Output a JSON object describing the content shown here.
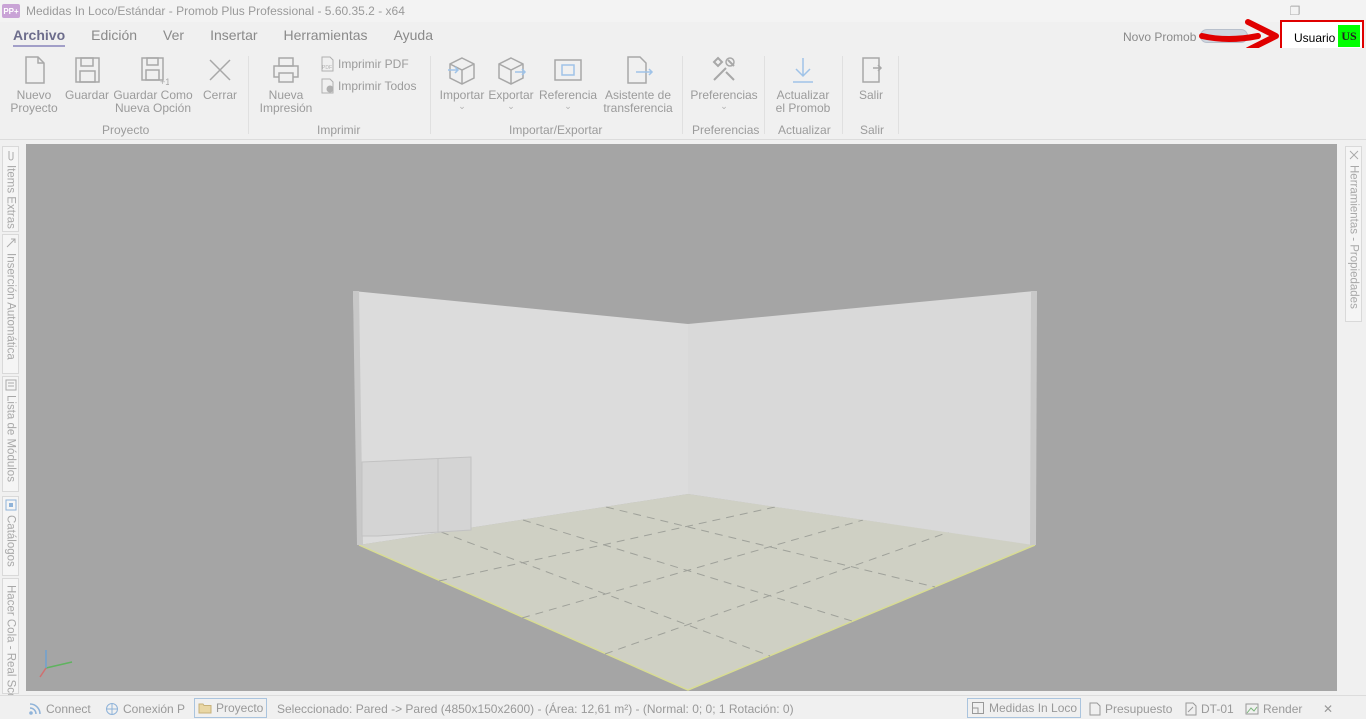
{
  "window": {
    "title": "Medidas In Loco/Estándar - Promob Plus Professional - 5.60.35.2 - x64",
    "logo_text": "PP+",
    "restore_glyph": "❐"
  },
  "menu": {
    "items": [
      {
        "label": "Archivo"
      },
      {
        "label": "Edición"
      },
      {
        "label": "Ver"
      },
      {
        "label": "Insertar"
      },
      {
        "label": "Herramientas"
      },
      {
        "label": "Ayuda"
      }
    ]
  },
  "topright": {
    "novo_label": "Novo Promob",
    "user_label": "Usuario",
    "user_initials": "US",
    "highlight_color": "#e00000",
    "avatar_color": "#00ff00"
  },
  "ribbon": {
    "nuevo": {
      "line1": "Nuevo",
      "line2": "Proyecto"
    },
    "guardar": {
      "line1": "Guardar"
    },
    "guardar_como": {
      "line1": "Guardar Como",
      "line2": "Nueva Opción"
    },
    "cerrar": {
      "line1": "Cerrar"
    },
    "nueva_impresion": {
      "line1": "Nueva",
      "line2": "Impresión"
    },
    "imprimir_pdf": "Imprimir PDF",
    "imprimir_todos": "Imprimir Todos",
    "importar": "Importar",
    "exportar": "Exportar",
    "referencia": "Referencia",
    "asistente": {
      "line1": "Asistente de",
      "line2": "transferencia"
    },
    "preferencias": "Preferencias",
    "actualizar": {
      "line1": "Actualizar",
      "line2": "el Promob"
    },
    "salir": "Salir",
    "chevron": "⌄",
    "groups": {
      "proyecto": "Proyecto",
      "imprimir": "Imprimir",
      "importar_exportar": "Importar/Exportar",
      "preferencias": "Preferencias",
      "actualizar": "Actualizar",
      "salir": "Salir"
    }
  },
  "left_tabs": [
    "Items Extras",
    "Inserción Automática",
    "Lista de Módulos",
    "Catálogos",
    "Hacer Cola - Real Scen"
  ],
  "right_tabs": [
    "Herramientas - Propiedades"
  ],
  "statusbar": {
    "connect": "Connect",
    "conexion": "Conexión P",
    "proyecto": "Proyecto",
    "selection": "Seleccionado: Pared -> Pared (4850x150x2600) - (Área: 12,61 m²) - (Normal: 0; 0; 1 Rotación: 0)",
    "medidas": "Medidas In Loco",
    "presupuesto": "Presupuesto",
    "dt": "DT-01",
    "render": "Render",
    "close_glyph": "✕"
  }
}
